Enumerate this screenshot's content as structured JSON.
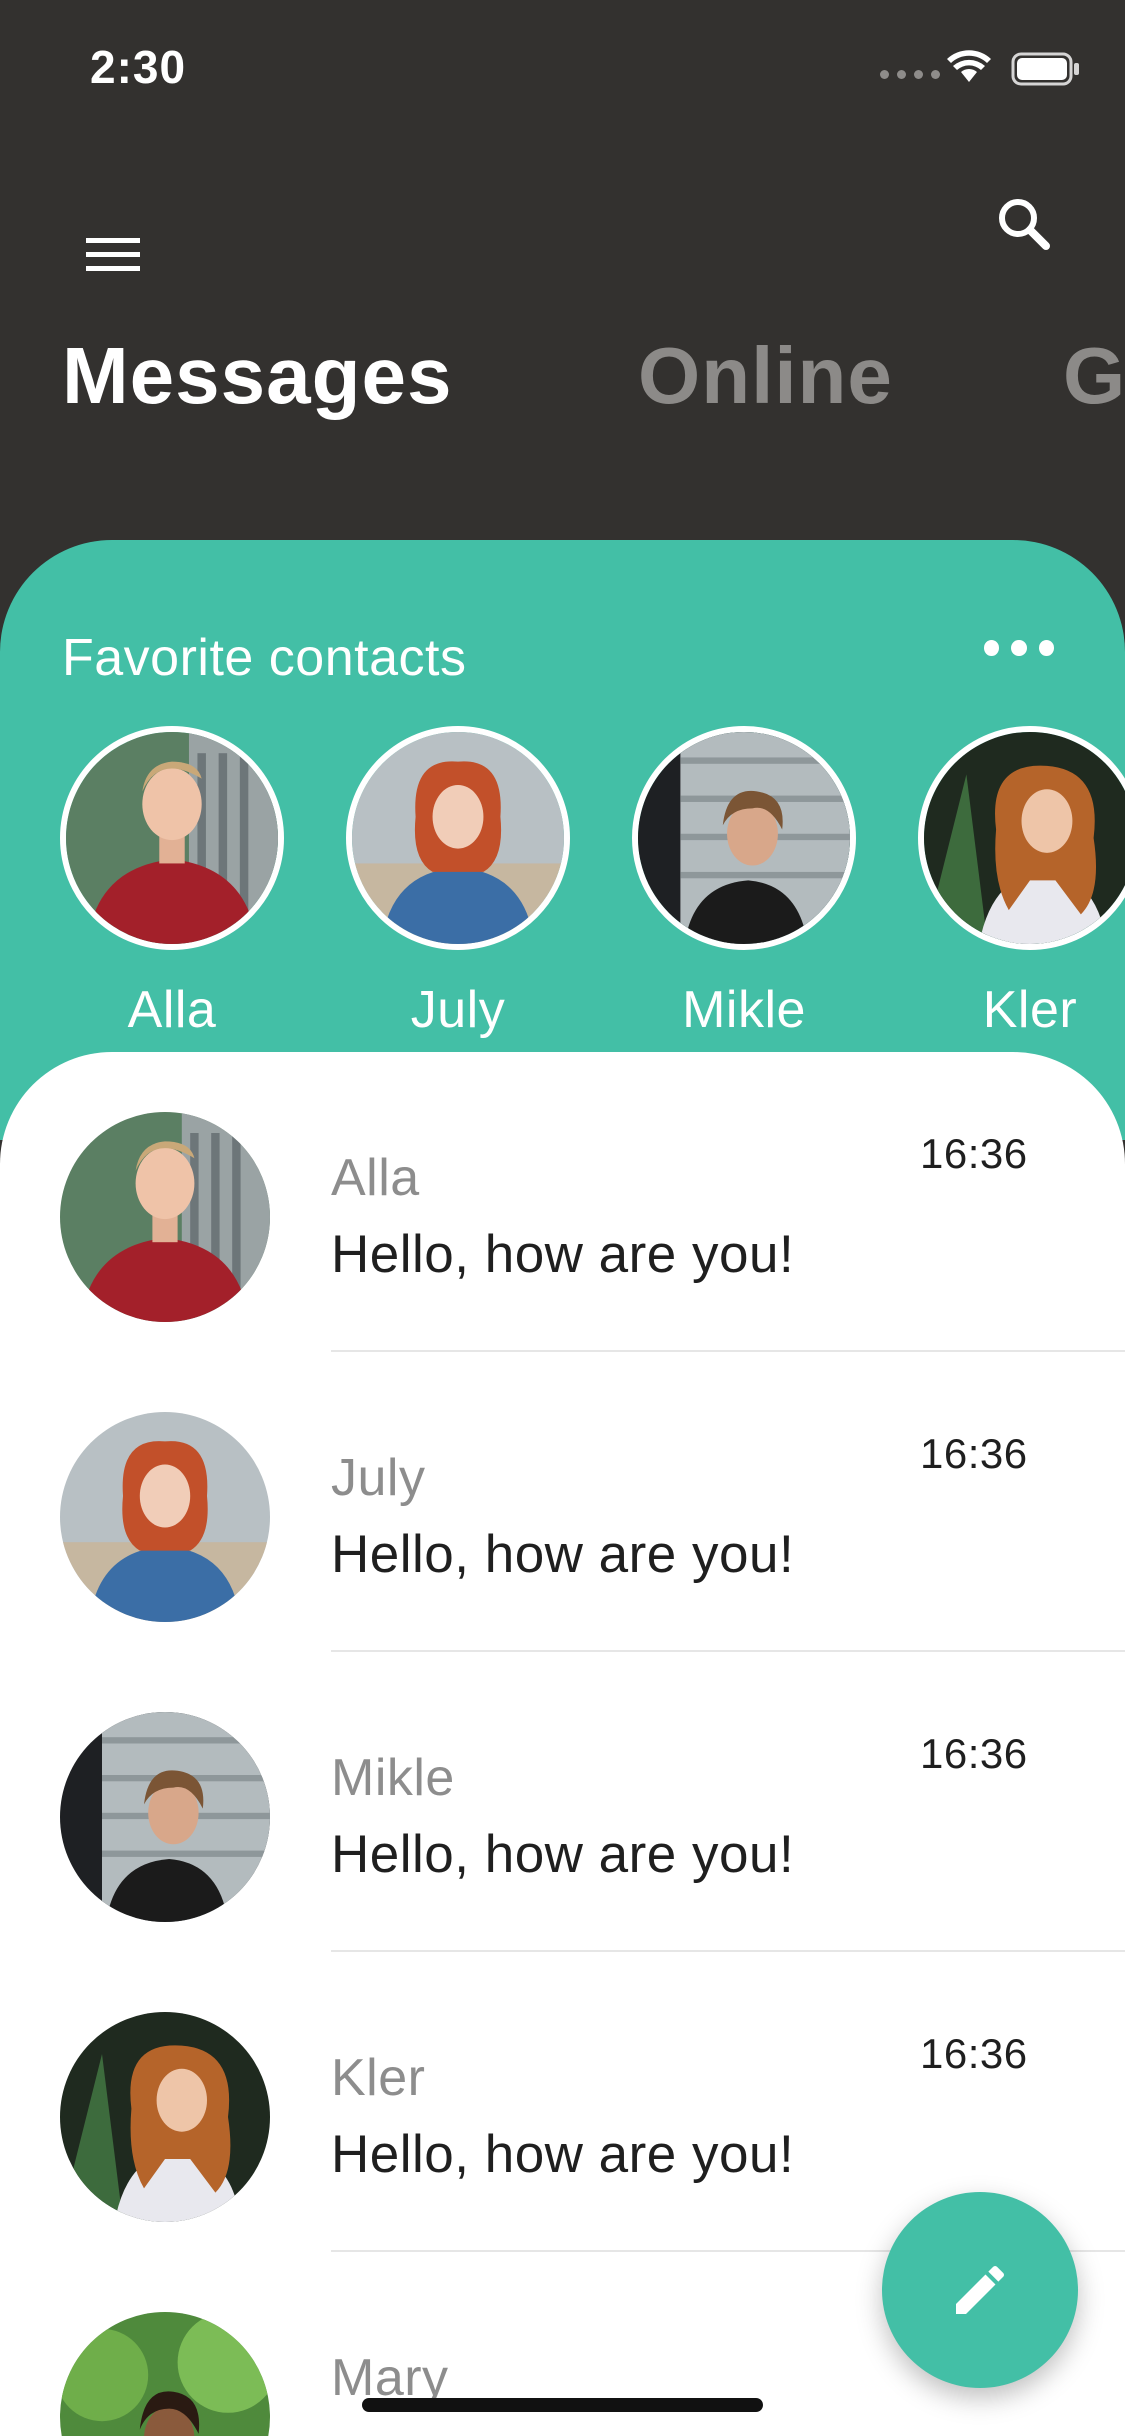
{
  "status_bar": {
    "time": "2:30"
  },
  "tabs": [
    {
      "label": "Messages",
      "active": true
    },
    {
      "label": "Online",
      "active": false
    },
    {
      "label": "G",
      "active": false
    }
  ],
  "favorites": {
    "title": "Favorite contacts",
    "contacts": [
      {
        "name": "Alla"
      },
      {
        "name": "July"
      },
      {
        "name": "Mikle"
      },
      {
        "name": "Kler"
      }
    ]
  },
  "chats": [
    {
      "name": "Alla",
      "message": "Hello, how are you!",
      "time": "16:36"
    },
    {
      "name": "July",
      "message": "Hello, how are you!",
      "time": "16:36"
    },
    {
      "name": "Mikle",
      "message": "Hello, how are you!",
      "time": "16:36"
    },
    {
      "name": "Kler",
      "message": "Hello, how are you!",
      "time": "16:36"
    },
    {
      "name": "Mary",
      "message": "",
      "time": ""
    }
  ],
  "icons": {
    "menu": "hamburger-menu-icon",
    "search": "search-icon",
    "more": "more-horizontal-icon",
    "compose": "pencil-edit-icon"
  },
  "colors": {
    "app_bar_bg": "#33312f",
    "accent": "#43bfa6",
    "inactive_tab": "#8c8a88",
    "message_name": "#8d8d8d"
  }
}
